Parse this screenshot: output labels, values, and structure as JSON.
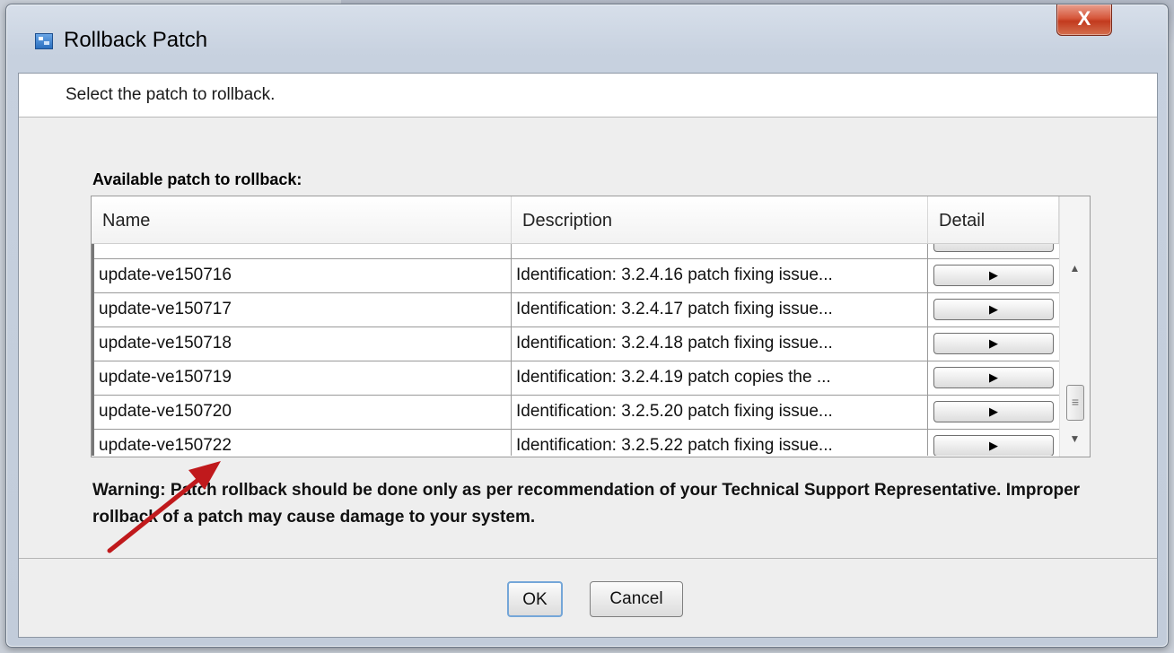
{
  "window": {
    "title": "Rollback Patch",
    "close_label": "X"
  },
  "instruction": "Select the patch to rollback.",
  "available_label": "Available patch to rollback:",
  "table": {
    "columns": [
      "Name",
      "Description",
      "Detail"
    ],
    "rows": [
      {
        "name": "update-ve150716",
        "description": "Identification: 3.2.4.16 patch fixing issue...",
        "detail": "▶"
      },
      {
        "name": "update-ve150717",
        "description": "Identification: 3.2.4.17 patch fixing issue...",
        "detail": "▶"
      },
      {
        "name": "update-ve150718",
        "description": "Identification: 3.2.4.18 patch fixing issue...",
        "detail": "▶"
      },
      {
        "name": "update-ve150719",
        "description": "Identification: 3.2.4.19 patch copies the ...",
        "detail": "▶"
      },
      {
        "name": "update-ve150720",
        "description": "Identification: 3.2.5.20 patch fixing issue...",
        "detail": "▶"
      },
      {
        "name": "update-ve150722",
        "description": "Identification: 3.2.5.22 patch fixing issue...",
        "detail": "▶"
      }
    ]
  },
  "warning": "Warning: Patch rollback should be done only as per recommendation of your Technical Support Representative. Improper rollback of a patch may cause damage to your system.",
  "buttons": {
    "ok": "OK",
    "cancel": "Cancel"
  },
  "scrollbar": {
    "up_glyph": "▲",
    "down_glyph": "▼",
    "thumb_glyph": "≡"
  },
  "colors": {
    "annotation_arrow": "#c0191c",
    "close_button": "#c9432a",
    "ok_focus": "#74a6d8"
  }
}
